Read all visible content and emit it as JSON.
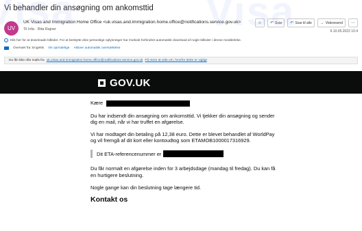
{
  "email": {
    "subject": "Vi behandler din ansøgning om ankomsttid",
    "avatar_initials": "UV",
    "avatar_color": "#c2398e",
    "sender": "UK Visas and Immigration Home Office <uk.visas.and.immigration.home.office@notifications.service.gov.uk>",
    "to": "Til  Infa · Rita Rajner",
    "date": "6.10.05.2022 10:4",
    "actions": [
      {
        "icon": "smiley-icon",
        "glyph": "☺",
        "label": ""
      },
      {
        "icon": "reply-icon",
        "glyph": "↶",
        "label": "Svar"
      },
      {
        "icon": "reply-all-icon",
        "glyph": "↶",
        "label": "Svar til alle"
      },
      {
        "icon": "forward-icon",
        "glyph": "→",
        "label": "Videresend"
      },
      {
        "icon": "more-icon",
        "glyph": "⋯",
        "label": ""
      }
    ],
    "info_line": "Klik her for at downloade billeder. For at beskytte dine personlige oplysninger har Outlook forhindret automatisk download af nogle billeder i denne meddelelse.",
    "translate_line": {
      "text": "Oversæt fra: Engelsk",
      "link1": "Vis oprindelige",
      "link2": "Aktiver automatisk oversættelse"
    },
    "external_sender": {
      "prefix": "Du får ikke ofte mails fra",
      "address": "uk.visas.and.immigration.home.office@notifications.service.gov.uk",
      "link": "Få mere at vide om, hvorfor dette er vigtigt"
    }
  },
  "body": {
    "brand": "GOV.UK",
    "brand_bar_color": "#0b0c0c",
    "greeting": "Kære",
    "para1": "Du har indsendt din ansøgning om ankomsttid. Vi tjekker din ansøgning og sender dig en mail, når vi har truffet en afgørelse.",
    "para2": "Vi har modtaget din betaling på 12,38 euro. Dette er blevet behandlet af WorldPay og vil fremgå af dit kort eller kontoudtog som ETAMOB1000017316929.",
    "inset": "Dit ETA-referencenummer er",
    "para3": "Du får normalt en afgørelse inden for 3 arbejdsdage (mandag til fredag). Du kan få en hurtigere beslutning.",
    "para4": "Nogle gange kan din beslutning tage længere tid.",
    "heading": "Kontakt os"
  },
  "watermark": "Visa"
}
